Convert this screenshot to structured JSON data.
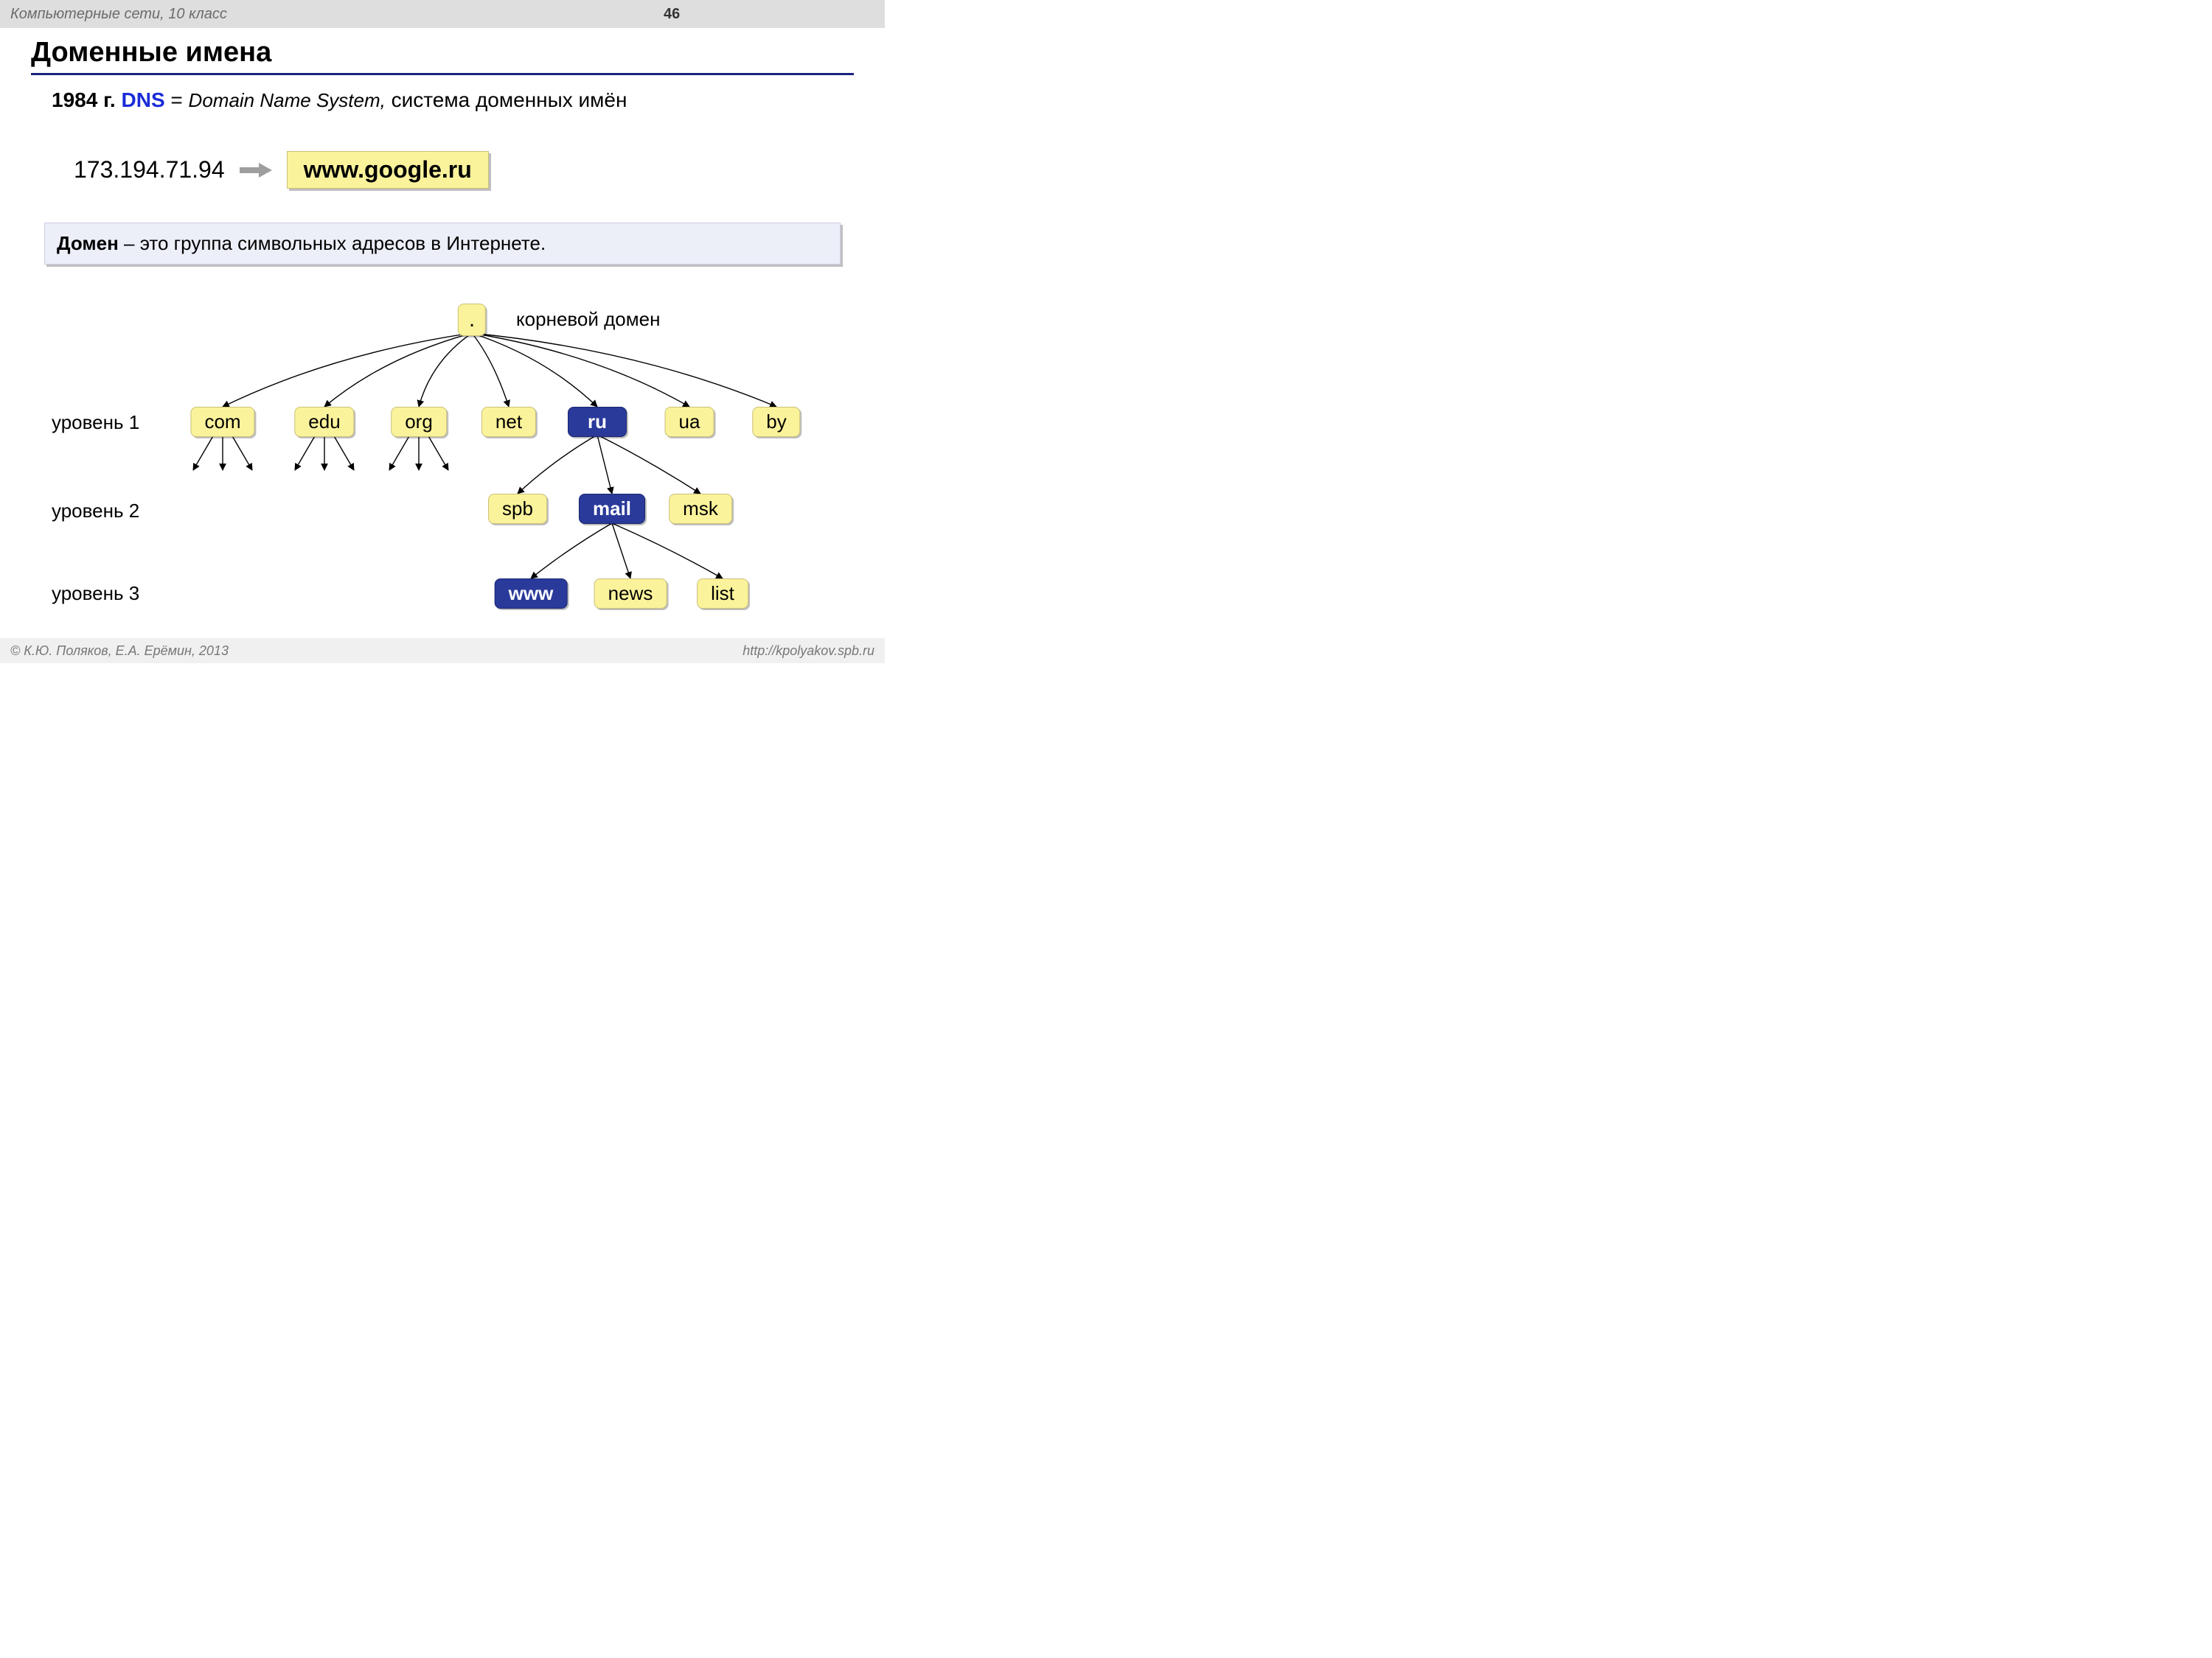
{
  "header": {
    "subject": "Компьютерные сети, 10 класс",
    "page": "46"
  },
  "title": "Доменные имена",
  "dns_line": {
    "year": "1984 г.",
    "abbr": "DNS",
    "eq": "=",
    "english": "Domain Name System,",
    "rus": "система доменных имён"
  },
  "ip_example": {
    "ip": "173.194.71.94",
    "domain": "www.google.ru"
  },
  "definition": {
    "term": "Домен",
    "rest": " – это группа символьных адресов в Интернете."
  },
  "tree": {
    "root": {
      "label": ".",
      "caption": "корневой домен"
    },
    "level_labels": [
      "уровень 1",
      "уровень 2",
      "уровень 3"
    ],
    "level1": [
      {
        "label": "com",
        "dark": false
      },
      {
        "label": "edu",
        "dark": false
      },
      {
        "label": "org",
        "dark": false
      },
      {
        "label": "net",
        "dark": false
      },
      {
        "label": "ru",
        "dark": true
      },
      {
        "label": "ua",
        "dark": false
      },
      {
        "label": "by",
        "dark": false
      }
    ],
    "level2": [
      {
        "label": "spb",
        "dark": false
      },
      {
        "label": "mail",
        "dark": true
      },
      {
        "label": "msk",
        "dark": false
      }
    ],
    "level3": [
      {
        "label": "www",
        "dark": true
      },
      {
        "label": "news",
        "dark": false
      },
      {
        "label": "list",
        "dark": false
      }
    ]
  },
  "footer": {
    "left": "© К.Ю. Поляков, Е.А. Ерёмин, 2013",
    "right": "http://kpolyakov.spb.ru"
  }
}
